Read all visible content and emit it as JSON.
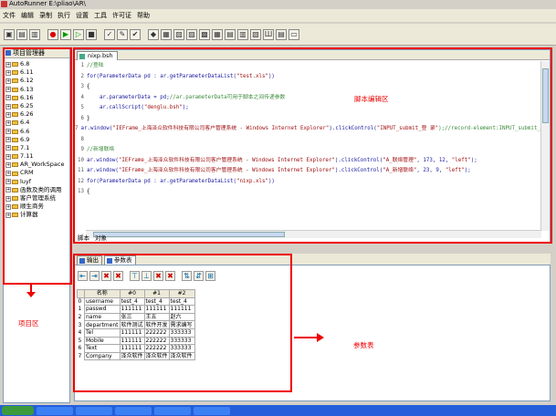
{
  "window": {
    "title": "AutoRunner  E:\\pliao\\AR\\"
  },
  "menu": [
    "文件",
    "编辑",
    "录制",
    "执行",
    "设置",
    "工具",
    "许可证",
    "帮助"
  ],
  "toolbar_icons": [
    "save-icon",
    "save-all-icon",
    "save-as-icon",
    "record-icon",
    "run-icon",
    "play-icon",
    "stop-icon",
    "checkpoint-icon",
    "edit-icon",
    "check-icon",
    "color-icon",
    "image-icon",
    "text-icon",
    "text-icon-2",
    "text-icon-3",
    "text-icon-4",
    "text-icon-5",
    "text-icon-6",
    "text-icon-7",
    "hh-icon",
    "text-icon-8",
    "window-icon"
  ],
  "left": {
    "title": "项目管理器",
    "items": [
      "6.8",
      "6.11",
      "6.12",
      "6.13",
      "6.16",
      "6.25",
      "6.26",
      "6.4",
      "6.6",
      "6.9",
      "7.1",
      "7.11",
      "AR_WorkSpace",
      "CRM",
      "luyf",
      "函数及类的调用",
      "客户管理系统",
      "顺生商务",
      "计算器"
    ]
  },
  "editor": {
    "tab": "nixp.bsh",
    "lines": [
      {
        "n": "1",
        "parts": [
          {
            "t": "//登陆",
            "c": "cm"
          }
        ]
      },
      {
        "n": "2",
        "parts": [
          {
            "t": "for(ParameterData pd : ar.getParameterDataList(",
            "c": "kw"
          },
          {
            "t": "\"test.xls\"",
            "c": "str"
          },
          {
            "t": "))",
            "c": "kw"
          }
        ]
      },
      {
        "n": "3",
        "parts": [
          {
            "t": "{",
            "c": ""
          }
        ]
      },
      {
        "n": "4",
        "parts": [
          {
            "t": "    ar.parameterData = pd;",
            "c": "kw"
          },
          {
            "t": "//ar.parameterData可用于脚本之间传递参数",
            "c": "cm"
          }
        ]
      },
      {
        "n": "5",
        "parts": [
          {
            "t": "    ar.callScript(",
            "c": "kw"
          },
          {
            "t": "\"denglu.bsh\"",
            "c": "str"
          },
          {
            "t": ");",
            "c": "kw"
          }
        ]
      },
      {
        "n": "6",
        "parts": [
          {
            "t": "}",
            "c": ""
          }
        ]
      },
      {
        "n": "7",
        "parts": [
          {
            "t": "ar.window(",
            "c": "kw"
          },
          {
            "t": "\"IEFrame_上海泽众软件科技有限公司客户管理系统 - Windows Internet Explorer\"",
            "c": "str"
          },
          {
            "t": ").clickControl(",
            "c": "kw"
          },
          {
            "t": "\"INPUT_submit_登 录\"",
            "c": "str"
          },
          {
            "t": ");//record-element:INPUT_submit_登 录",
            "c": "cm"
          }
        ]
      },
      {
        "n": "8",
        "parts": [
          {
            "t": "",
            "c": ""
          }
        ]
      },
      {
        "n": "9",
        "parts": [
          {
            "t": "//新增联络",
            "c": "cm"
          }
        ]
      },
      {
        "n": "10",
        "parts": [
          {
            "t": "ar.window(",
            "c": "kw"
          },
          {
            "t": "\"IEFrame_上海泽众软件科技有限公司客户管理系统 - Windows Internet Explorer\"",
            "c": "str"
          },
          {
            "t": ").clickControl(",
            "c": "kw"
          },
          {
            "t": "\"A_联络管理\"",
            "c": "str"
          },
          {
            "t": ", 173, 12, ",
            "c": "kw"
          },
          {
            "t": "\"left\"",
            "c": "str"
          },
          {
            "t": ");",
            "c": "kw"
          }
        ]
      },
      {
        "n": "11",
        "parts": [
          {
            "t": "ar.window(",
            "c": "kw"
          },
          {
            "t": "\"IEFrame_上海泽众软件科技有限公司客户管理系统 - Windows Internet Explorer\"",
            "c": "str"
          },
          {
            "t": ").clickControl(",
            "c": "kw"
          },
          {
            "t": "\"A_新增联络\"",
            "c": "str"
          },
          {
            "t": ", 23, 9, ",
            "c": "kw"
          },
          {
            "t": "\"left\"",
            "c": "str"
          },
          {
            "t": ");",
            "c": "kw"
          }
        ]
      },
      {
        "n": "12",
        "parts": [
          {
            "t": "for(ParameterData pd : ar.getParameterDataList(",
            "c": "kw"
          },
          {
            "t": "\"nixp.xls\"",
            "c": "str"
          },
          {
            "t": "))",
            "c": "kw"
          }
        ]
      },
      {
        "n": "13",
        "parts": [
          {
            "t": "{",
            "c": ""
          }
        ]
      }
    ]
  },
  "editor_bottom_tabs": [
    "脚本",
    "对象"
  ],
  "lower_tabs": [
    "输出",
    "参数表"
  ],
  "param_table": {
    "headers": [
      "",
      "名称",
      "#0",
      "#1",
      "#2"
    ],
    "rows": [
      [
        "0",
        "username",
        "test_4",
        "test_4",
        "test_4"
      ],
      [
        "1",
        "passwd",
        "111111",
        "111111",
        "111111"
      ],
      [
        "2",
        "name",
        "张三",
        "王五",
        "赵六"
      ],
      [
        "3",
        "department",
        "软件测试",
        "软件开发",
        "需求编写"
      ],
      [
        "4",
        "Tel",
        "111111",
        "222222",
        "333333"
      ],
      [
        "5",
        "Mobile",
        "111111",
        "222222",
        "333333"
      ],
      [
        "6",
        "Text",
        "111111",
        "222222",
        "333333"
      ],
      [
        "7",
        "Company",
        "泽众软件",
        "泽众软件",
        "泽众软件"
      ]
    ]
  },
  "annotations": {
    "editor": "脚本编辑区",
    "project": "项目区",
    "params": "参数表"
  }
}
